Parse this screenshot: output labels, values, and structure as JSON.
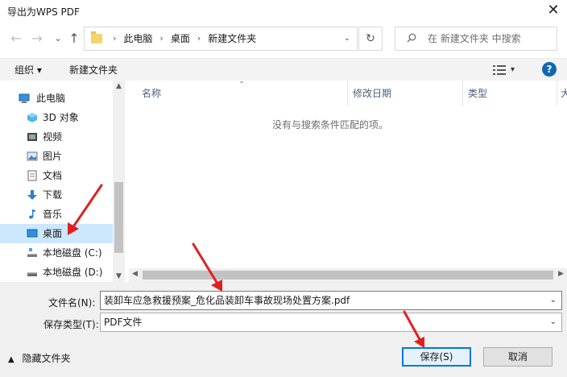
{
  "window": {
    "title": "导出为WPS PDF",
    "close_glyph": "✕"
  },
  "nav_buttons": {
    "back": "←",
    "forward": "→",
    "recent": "⌄",
    "up": "↑"
  },
  "address": {
    "crumbs": [
      "此电脑",
      "桌面",
      "新建文件夹"
    ],
    "separator": "›",
    "dropdown": "⌄",
    "refresh": "↻"
  },
  "search": {
    "placeholder": "在 新建文件夹 中搜索"
  },
  "toolbar": {
    "organize": "组织 ▾",
    "new_folder": "新建文件夹",
    "view_caret": "▾",
    "help": "?"
  },
  "nav_pane": {
    "items": [
      {
        "label": "此电脑",
        "icon": "computer-icon"
      },
      {
        "label": "3D 对象",
        "icon": "cube-3d-icon"
      },
      {
        "label": "视频",
        "icon": "video-icon"
      },
      {
        "label": "图片",
        "icon": "picture-icon"
      },
      {
        "label": "文档",
        "icon": "document-icon"
      },
      {
        "label": "下载",
        "icon": "download-icon"
      },
      {
        "label": "音乐",
        "icon": "music-icon"
      },
      {
        "label": "桌面",
        "icon": "desktop-icon",
        "selected": true
      },
      {
        "label": "本地磁盘 (C:)",
        "icon": "drive-icon"
      },
      {
        "label": "本地磁盘 (D:)",
        "icon": "drive-icon"
      }
    ]
  },
  "file_list": {
    "columns": [
      "名称",
      "修改日期",
      "类型",
      "大"
    ],
    "empty_message": "没有与搜索条件匹配的项。"
  },
  "save_form": {
    "filename_label": "文件名(N):",
    "filename_value": "装卸车应急救援预案_危化品装卸车事故现场处置方案.pdf",
    "type_label": "保存类型(T):",
    "type_value": "PDF文件"
  },
  "footer": {
    "hide_folders": "隐藏文件夹",
    "save": "保存(S)",
    "cancel": "取消"
  },
  "colors": {
    "accent": "#0078d7",
    "annotation_arrow": "#e02020",
    "selected_bg": "#cce8ff"
  }
}
